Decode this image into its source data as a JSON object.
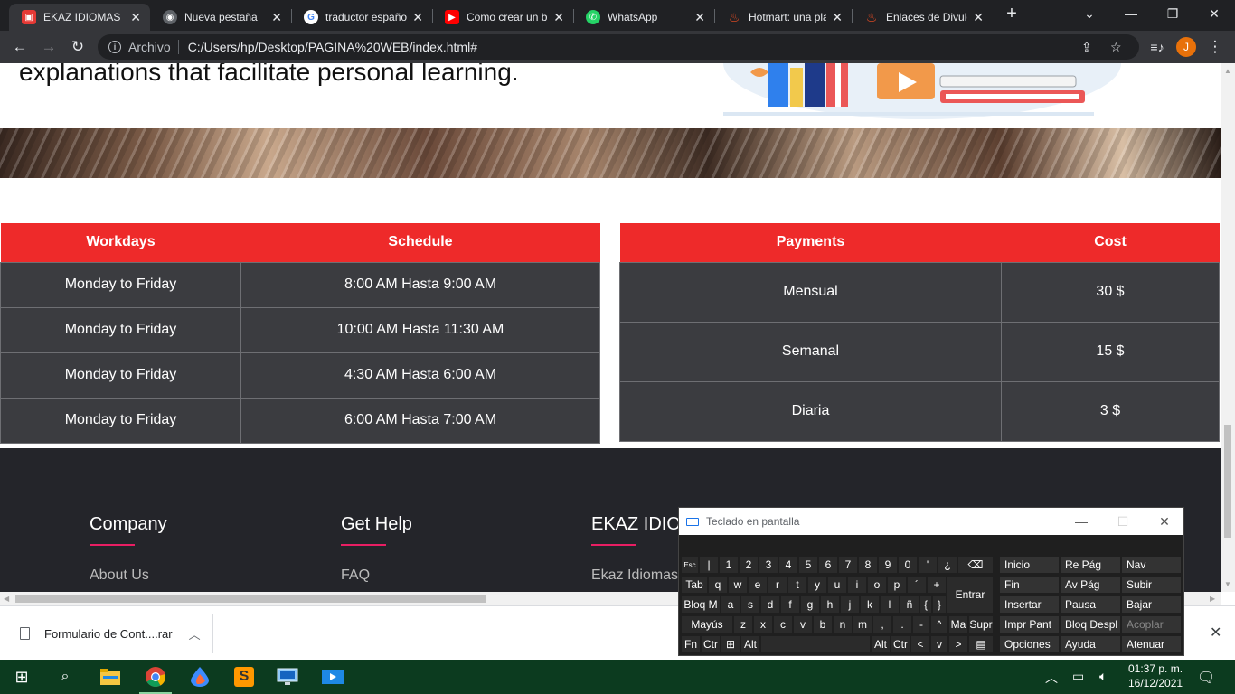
{
  "browser": {
    "tabs": [
      {
        "title": "EKAZ IDIOMAS",
        "favicon": "ekaz-icon",
        "color": "#e53935",
        "active": true
      },
      {
        "title": "Nueva pestaña",
        "favicon": "chrome-icon",
        "color": "#9aa0a6",
        "active": false
      },
      {
        "title": "traductor españo",
        "favicon": "google-icon",
        "color": "#4285f4",
        "active": false
      },
      {
        "title": "Como crear un b",
        "favicon": "youtube-icon",
        "color": "#ff0000",
        "active": false
      },
      {
        "title": "WhatsApp",
        "favicon": "whatsapp-icon",
        "color": "#25d366",
        "active": false
      },
      {
        "title": "Hotmart: una pla",
        "favicon": "hotmart-icon",
        "color": "#f04e23",
        "active": false
      },
      {
        "title": "Enlaces de Divulg",
        "favicon": "hotmart-icon",
        "color": "#f04e23",
        "active": false
      }
    ],
    "new_tab": "+",
    "address": {
      "protocol_label": "Archivo",
      "url": "C:/Users/hp/Desktop/PAGINA%20WEB/index.html#"
    },
    "profile_initial": "J"
  },
  "page": {
    "hero_text": "explanations that facilitate personal learning.",
    "schedule_table": {
      "headers": [
        "Workdays",
        "Schedule"
      ],
      "rows": [
        [
          "Monday to Friday",
          "8:00 AM Hasta 9:00 AM"
        ],
        [
          "Monday to Friday",
          "10:00 AM Hasta 11:30 AM"
        ],
        [
          "Monday to Friday",
          "4:30 AM Hasta 6:00 AM"
        ],
        [
          "Monday to Friday",
          "6:00 AM Hasta 7:00 AM"
        ]
      ]
    },
    "payments_table": {
      "headers": [
        "Payments",
        "Cost"
      ],
      "rows": [
        [
          "Mensual",
          "30 $"
        ],
        [
          "Semanal",
          "15 $"
        ],
        [
          "Diaria",
          "3 $"
        ]
      ]
    },
    "footer": {
      "columns": [
        {
          "title": "Company",
          "first_link": "About Us"
        },
        {
          "title": "Get Help",
          "first_link": "FAQ"
        },
        {
          "title": "EKAZ IDIOMAS",
          "first_link": "Ekaz Idiomas"
        }
      ]
    }
  },
  "downloads": {
    "item": "Formulario de Cont....rar"
  },
  "osk": {
    "title": "Teclado en pantalla",
    "row1": [
      "Esc",
      "|",
      "1",
      "2",
      "3",
      "4",
      "5",
      "6",
      "7",
      "8",
      "9",
      "0",
      "'",
      "¿",
      "⌫"
    ],
    "row2": [
      "Tab",
      "q",
      "w",
      "e",
      "r",
      "t",
      "y",
      "u",
      "i",
      "o",
      "p",
      "´",
      "+",
      "Entrar"
    ],
    "row3": [
      "Bloq M",
      "a",
      "s",
      "d",
      "f",
      "g",
      "h",
      "j",
      "k",
      "l",
      "ñ",
      "{",
      "}"
    ],
    "row4": [
      "Mayús",
      "z",
      "x",
      "c",
      "v",
      "b",
      "n",
      "m",
      ",",
      ".",
      "-",
      "^",
      "Ma",
      "Supr"
    ],
    "row5": [
      "Fn",
      "Ctr",
      "⊞",
      "Alt",
      "Alt",
      "Ctr",
      "<",
      "v",
      ">",
      "▤"
    ],
    "side": [
      [
        "Inicio",
        "Re Pág",
        "Nav"
      ],
      [
        "Fin",
        "Av Pág",
        "Subir"
      ],
      [
        "Insertar",
        "Pausa",
        "Bajar"
      ],
      [
        "Impr Pant",
        "Bloq Despl",
        "Acoplar"
      ],
      [
        "Opciones",
        "Ayuda",
        "Atenuar"
      ]
    ]
  },
  "taskbar": {
    "time": "01:37 p. m.",
    "date": "16/12/2021"
  }
}
